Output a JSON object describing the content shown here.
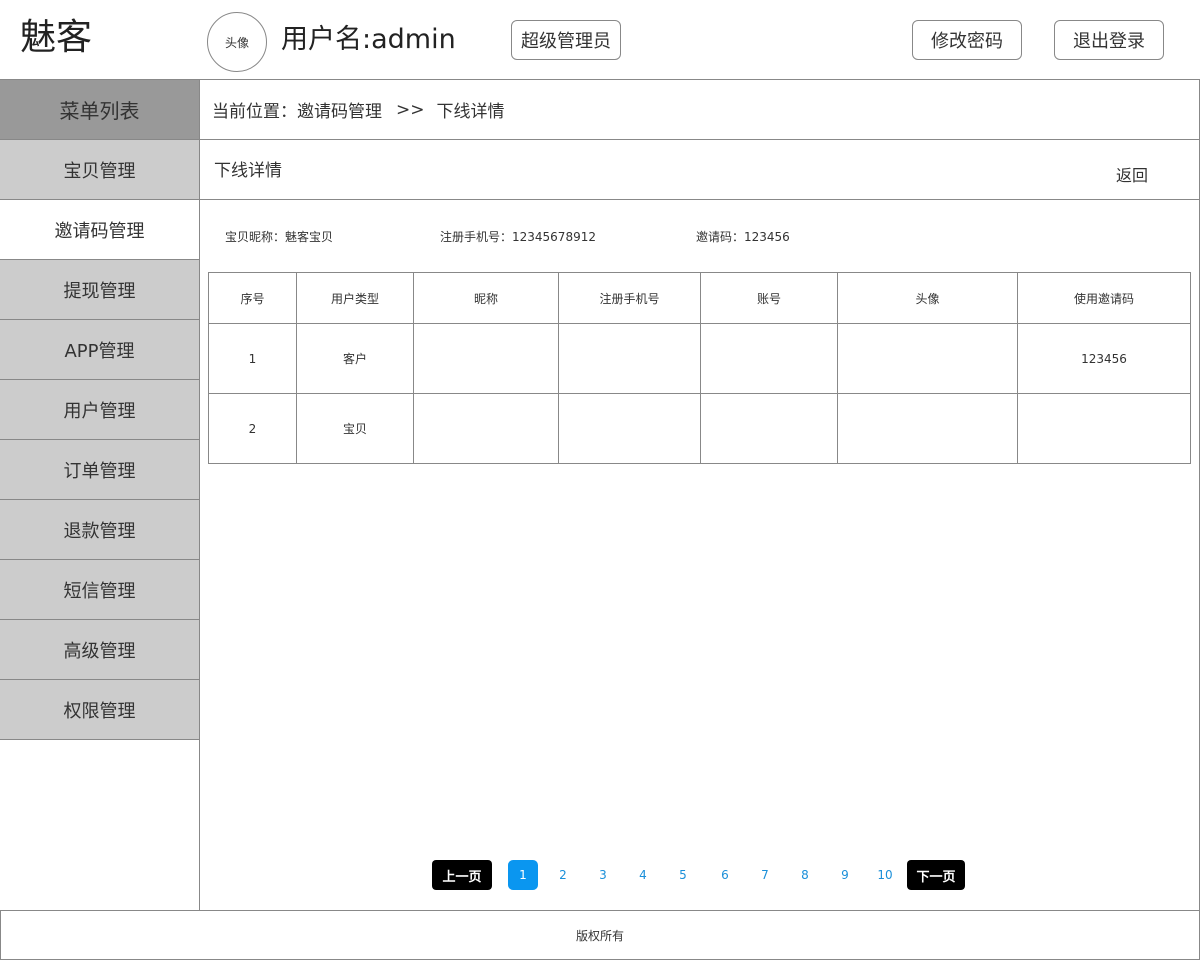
{
  "header": {
    "logo": "魅客",
    "avatar_label": "头像",
    "username": "用户名:admin",
    "role_label": "超级管理员",
    "change_password_label": "修改密码",
    "logout_label": "退出登录"
  },
  "sidebar": {
    "title": "菜单列表",
    "items": [
      {
        "label": "宝贝管理"
      },
      {
        "label": "邀请码管理"
      },
      {
        "label": "提现管理"
      },
      {
        "label": "APP管理"
      },
      {
        "label": "用户管理"
      },
      {
        "label": "订单管理"
      },
      {
        "label": "退款管理"
      },
      {
        "label": "短信管理"
      },
      {
        "label": "高级管理"
      },
      {
        "label": "权限管理"
      }
    ],
    "active_index": 1
  },
  "breadcrumb": {
    "prefix": "当前位置：邀请码管理",
    "separator": ">>",
    "current": "下线详情"
  },
  "subheader": {
    "title": "下线详情",
    "back_label": "返回"
  },
  "info": {
    "nickname": "宝贝昵称：魅客宝贝",
    "phone": "注册手机号：12345678912",
    "invite_code": "邀请码：123456"
  },
  "table": {
    "columns": [
      "序号",
      "用户类型",
      "昵称",
      "注册手机号",
      "账号",
      "头像",
      "使用邀请码"
    ],
    "rows": [
      [
        "1",
        "客户",
        "",
        "",
        "",
        "",
        "123456"
      ],
      [
        "2",
        "宝贝",
        "",
        "",
        "",
        "",
        ""
      ]
    ]
  },
  "pagination": {
    "prev_label": "上一页",
    "next_label": "下一页",
    "pages": [
      "1",
      "2",
      "3",
      "4",
      "5",
      "6",
      "7",
      "8",
      "9",
      "10"
    ],
    "current_page": "1"
  },
  "footer": {
    "text": "版权所有"
  },
  "colors": {
    "sidebar_title_bg": "#999999",
    "sidebar_item_bg": "#cccccc",
    "page_current_bg": "#0a96f0",
    "page_link": "#1a8fd9",
    "nav_button_bg": "#000000"
  }
}
